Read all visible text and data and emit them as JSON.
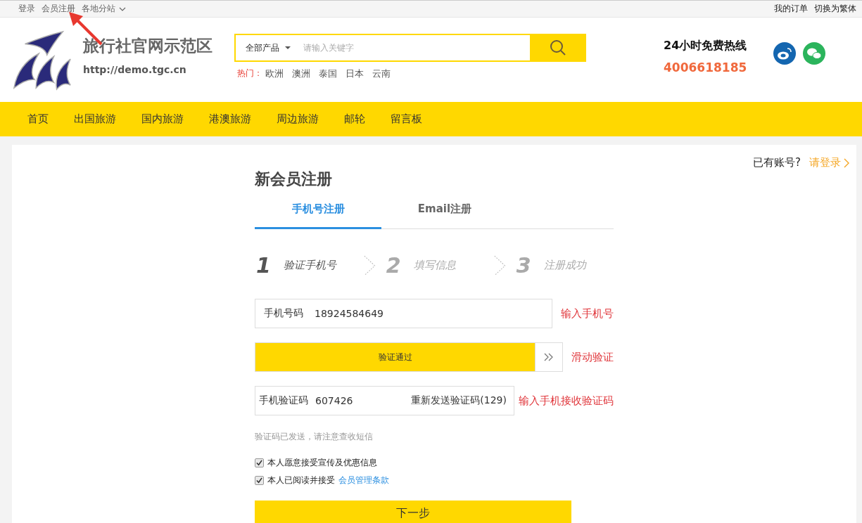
{
  "top_bar": {
    "left_links": [
      "登录",
      "会员注册",
      "各地分站"
    ],
    "right_links": [
      "我的订单",
      "切换为繁体"
    ]
  },
  "header": {
    "site_name": "旅行社官网示范区",
    "site_url": "http://demo.tgc.cn",
    "search": {
      "category": "全部产品",
      "placeholder": "请输入关键字"
    },
    "hot_label": "热门：",
    "hot_links": [
      "欧洲",
      "澳洲",
      "泰国",
      "日本",
      "云南"
    ],
    "hotline_label": "24小时免费热线",
    "hotline_number": "4006618185"
  },
  "nav": [
    "首页",
    "出国旅游",
    "国内旅游",
    "港澳旅游",
    "周边旅游",
    "邮轮",
    "留言板"
  ],
  "login_prompt": {
    "text": "已有账号?",
    "link": "请登录"
  },
  "form": {
    "title": "新会员注册",
    "tabs": [
      {
        "label": "手机号注册",
        "selected": true
      },
      {
        "label": "Email注册",
        "selected": false
      }
    ],
    "steps": [
      {
        "number": "1",
        "label": "验证手机号",
        "selected": true
      },
      {
        "number": "2",
        "label": "填写信息",
        "selected": false
      },
      {
        "number": "3",
        "label": "注册成功",
        "selected": false
      }
    ],
    "phone": {
      "label": "手机号码",
      "value": "18924584649",
      "note": "输入手机号"
    },
    "slider": {
      "label": "验证通过",
      "level": 1,
      "note": "滑动验证"
    },
    "code": {
      "label": "手机验证码",
      "value": "607426",
      "resend": "重新发送验证码(129)",
      "note": "输入手机接收验证码"
    },
    "hint": "验证码已发送，请注意查收短信",
    "agreements": [
      {
        "text": "本人愿意接受宣传及优惠信息",
        "checked": true
      },
      {
        "text": "本人已阅读并接受",
        "link": "会员管理条款",
        "checked": true
      }
    ],
    "submit": "下一步"
  }
}
